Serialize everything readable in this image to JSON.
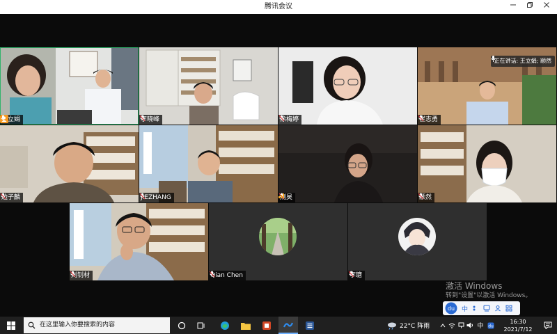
{
  "window": {
    "title": "腾讯会议"
  },
  "participants": [
    {
      "name": "王立娟"
    },
    {
      "name": "李晓峰"
    },
    {
      "name": "涂梅婷"
    },
    {
      "name": "崔志勇"
    },
    {
      "name": "边子麟"
    },
    {
      "name": "JIEZHANG"
    },
    {
      "name": "荆昊"
    },
    {
      "name": "颛然"
    },
    {
      "name": "刘钊材"
    },
    {
      "name": "Qian Chen"
    },
    {
      "name": "李瑭"
    }
  ],
  "speaking": {
    "text": "正在讲话: 王立娟; 颛然"
  },
  "activation": {
    "line1": "激活 Windows",
    "line2": "转到\"设置\"以激活 Windows。"
  },
  "ime": {
    "logo": "du",
    "mode": "中"
  },
  "taskbar": {
    "search_placeholder": "在这里输入你要搜索的内容",
    "weather": "22°C 阵雨",
    "lang": "中",
    "time": "16:30",
    "date": "2021/7/12"
  },
  "colors": {
    "accent_active": "#2fb36b",
    "mic_red": "#e5484d",
    "host_orange": "#f59a23"
  }
}
